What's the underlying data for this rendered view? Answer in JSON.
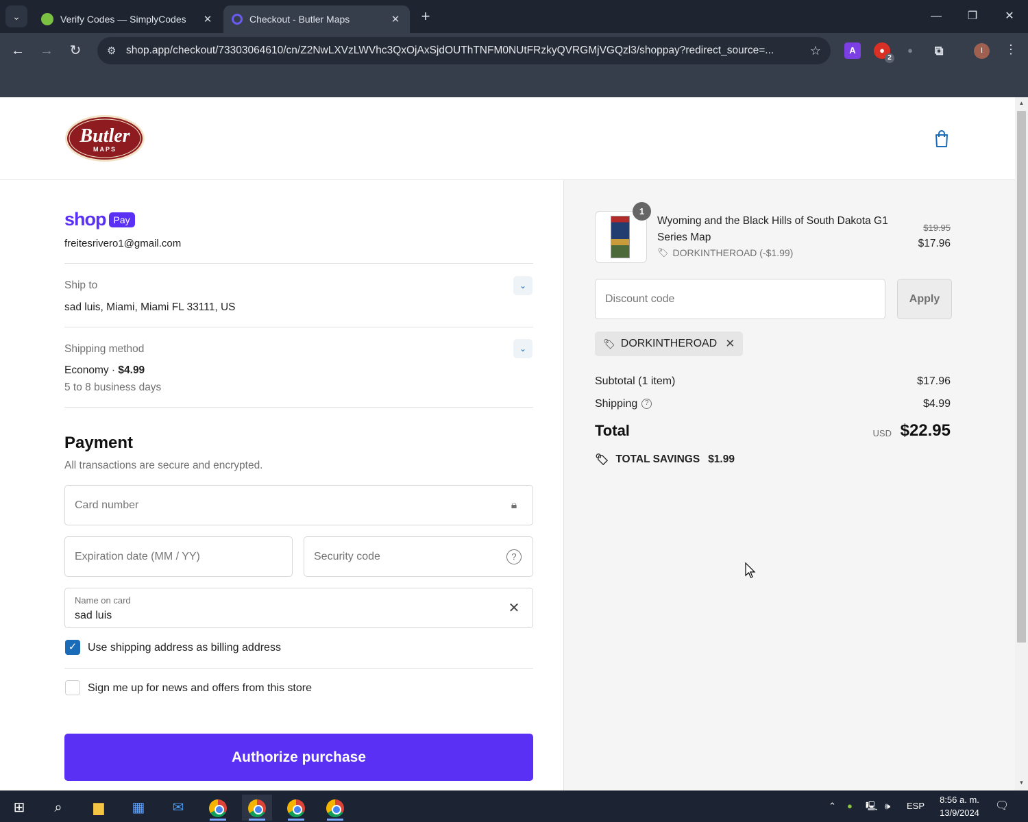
{
  "browser": {
    "tabs": [
      {
        "title": "Verify Codes — SimplyCodes",
        "favicon": "simplycodes-icon",
        "active": false
      },
      {
        "title": "Checkout - Butler Maps",
        "favicon": "butler-icon",
        "active": true
      }
    ],
    "url": "shop.app/checkout/73303064610/cn/Z2NwLXVzLWVhc3QxOjAxSjdOUThTNFM0NUtFRzkyQVRGMjVGQzl3/shoppay?redirect_source=...",
    "extension_badge": "2",
    "profile_initial": "I"
  },
  "store": {
    "logo_text": "Butler",
    "logo_subtext": "MAPS"
  },
  "checkout": {
    "shoppay_shop": "shop",
    "shoppay_pay": "Pay",
    "email": "freitesrivero1@gmail.com",
    "ship_to_label": "Ship to",
    "ship_to_value": "sad luis, Miami, Miami FL 33111, US",
    "shipping_method_label": "Shipping method",
    "shipping_method_name": "Economy · ",
    "shipping_method_price": "$4.99",
    "shipping_method_time": "5 to 8 business days",
    "payment_title": "Payment",
    "payment_subtitle": "All transactions are secure and encrypted.",
    "card_number_placeholder": "Card number",
    "expiration_placeholder": "Expiration date (MM / YY)",
    "security_code_placeholder": "Security code",
    "name_on_card_label": "Name on card",
    "name_on_card_value": "sad luis",
    "billing_checkbox_label": "Use shipping address as billing address",
    "billing_checkbox_checked": true,
    "newsletter_label": "Sign me up for news and offers from this store",
    "newsletter_checked": false,
    "authorize_label": "Authorize purchase"
  },
  "summary": {
    "product": {
      "quantity": "1",
      "name": "Wyoming and the Black Hills of South Dakota G1 Series Map",
      "discount_line": "DORKINTHEROAD (-$1.99)",
      "original_price": "$19.95",
      "price": "$17.96"
    },
    "discount_placeholder": "Discount code",
    "apply_label": "Apply",
    "applied_code": "DORKINTHEROAD",
    "subtotal_label": "Subtotal (1 item)",
    "subtotal_value": "$17.96",
    "shipping_label": "Shipping",
    "shipping_value": "$4.99",
    "total_label": "Total",
    "total_currency": "USD",
    "total_value": "$22.95",
    "savings_label": "TOTAL SAVINGS",
    "savings_value": "$1.99"
  },
  "taskbar": {
    "language": "ESP",
    "time": "8:56 a. m.",
    "date": "13/9/2024"
  },
  "colors": {
    "accent": "#5a31f4",
    "checkbox": "#1a6bb8"
  }
}
